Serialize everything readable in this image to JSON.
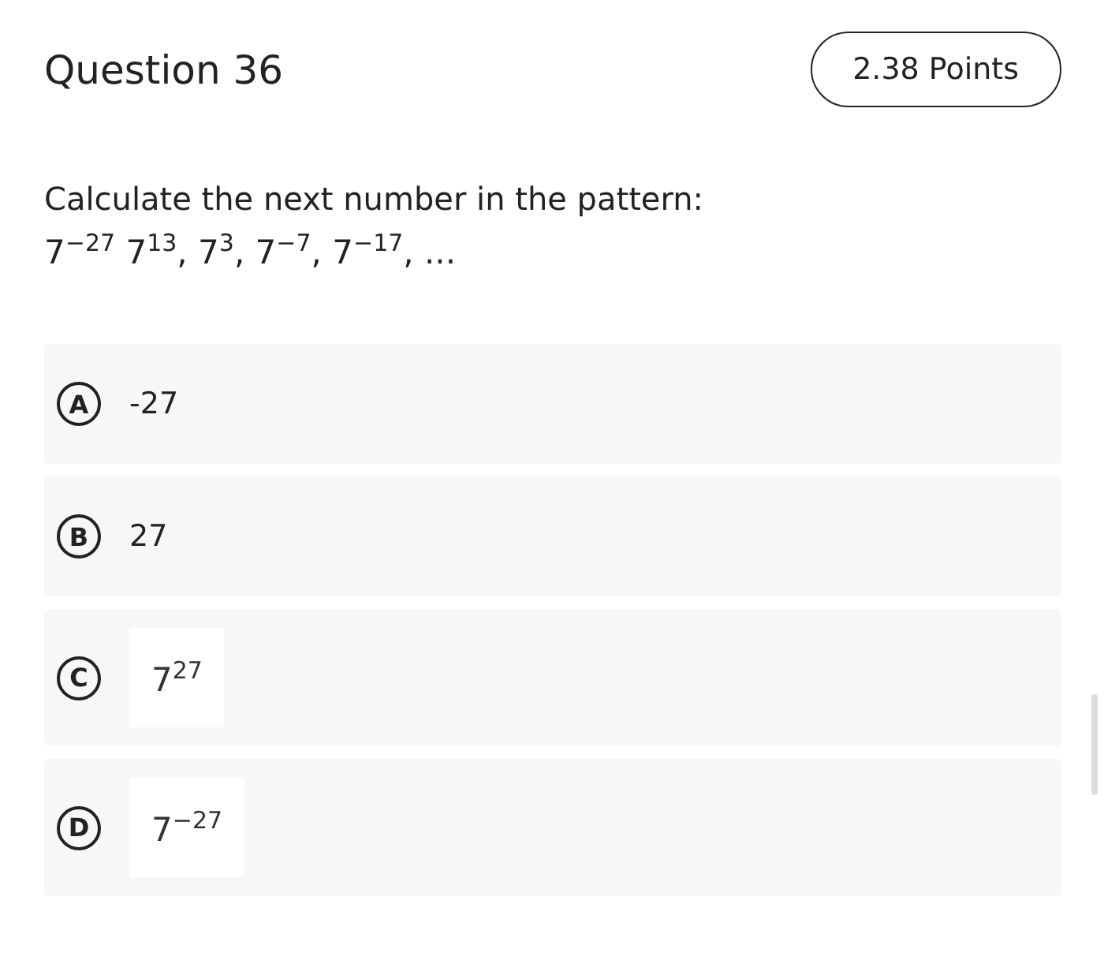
{
  "question": {
    "title": "Question 36",
    "points": "2.38 Points",
    "prompt": "Calculate the next number in the pattern:",
    "sequence": "7$^{−27}$ 7$^{13}$, 7$^{3}$, 7$^{−7}$, 7$^{−17}$, ..."
  },
  "options": [
    {
      "letter": "A",
      "kind": "text",
      "text": "-27"
    },
    {
      "letter": "B",
      "kind": "text",
      "text": "27"
    },
    {
      "letter": "C",
      "kind": "math",
      "text": "7$^{27}$"
    },
    {
      "letter": "D",
      "kind": "math",
      "text": "7$^{−27}$"
    }
  ]
}
